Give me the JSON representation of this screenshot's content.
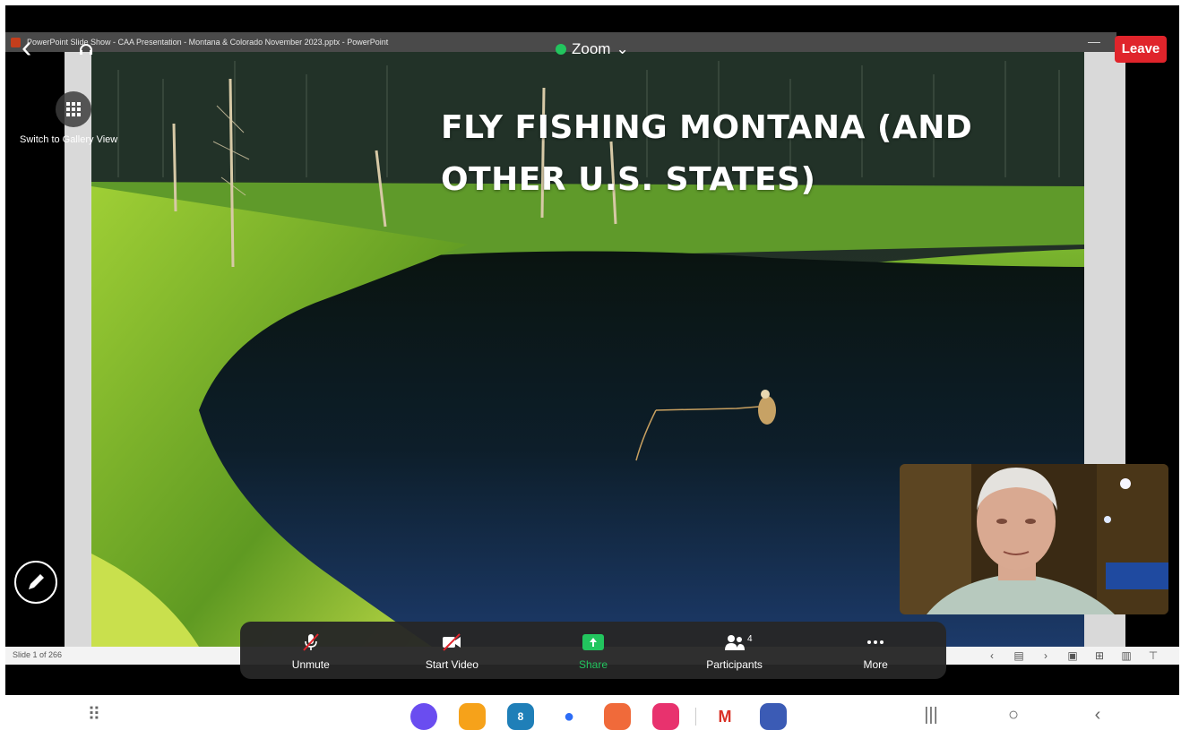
{
  "ppt_window": {
    "title": "PowerPoint Slide Show  -  CAA Presentation - Montana & Colorado November 2023.pptx - PowerPoint",
    "slide_counter": "Slide 1 of 266"
  },
  "slide": {
    "title": "FLY FISHING MONTANA (AND OTHER U.S. STATES)"
  },
  "zoom_header": {
    "app_name": "Zoom",
    "leave_label": "Leave",
    "gallery_label": "Switch to Gallery View"
  },
  "toolbar": {
    "unmute": "Unmute",
    "start_video": "Start Video",
    "share": "Share",
    "participants": "Participants",
    "participants_count": "4",
    "more": "More"
  },
  "colors": {
    "leave": "#e0242b",
    "share_accent": "#22c55e",
    "toolbar_bg": "#262626"
  },
  "dock": {
    "apps": [
      "internet-icon",
      "files-icon",
      "calendar-icon",
      "messages-icon",
      "contacts-icon",
      "camera-icon",
      "gmail-icon",
      "settings-icon"
    ],
    "calendar_day": "8"
  },
  "icons": {
    "back": "back-chevron-icon",
    "gallery": "grid-icon",
    "annotate": "pencil-icon"
  }
}
